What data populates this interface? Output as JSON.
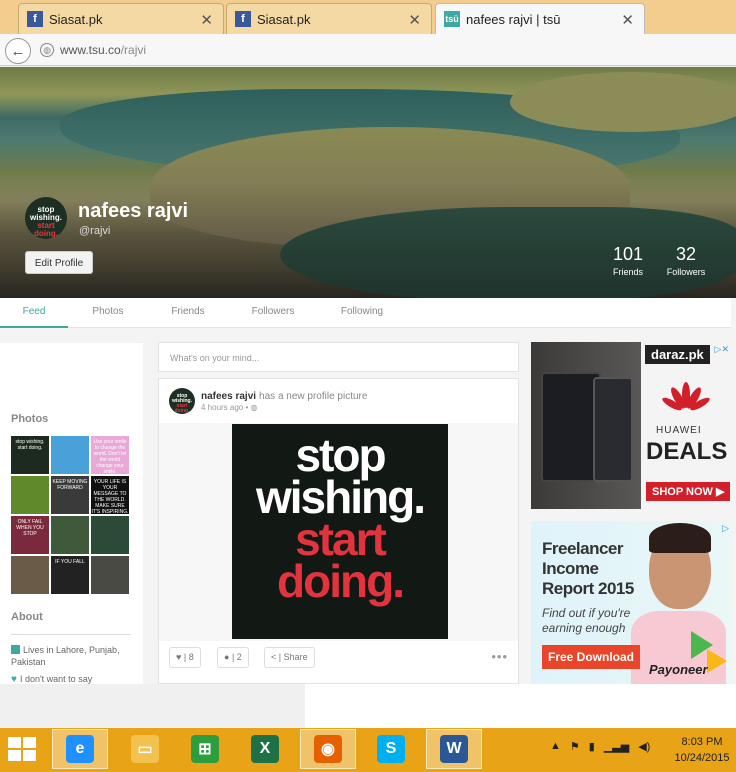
{
  "browser": {
    "tabs": [
      {
        "title": "Siasat.pk",
        "favicon": "facebook-icon"
      },
      {
        "title": "Siasat.pk",
        "favicon": "facebook-icon"
      },
      {
        "title": "nafees rajvi | tsū",
        "favicon": "tsu-icon",
        "active": true
      }
    ],
    "favicon_tsu_text": "tsū",
    "url_host": "www.tsu.co",
    "url_path": "/rajvi"
  },
  "profile": {
    "name": "nafees rajvi",
    "handle": "@rajvi",
    "edit_label": "Edit Profile",
    "avatar_text_1": "stop",
    "avatar_text_2": "wishing.",
    "avatar_text_3": "start",
    "avatar_text_4": "doing.",
    "friends_count": "101",
    "friends_label": "Friends",
    "followers_count": "32",
    "followers_label": "Followers"
  },
  "nav": {
    "tabs": [
      "Feed",
      "Photos",
      "Friends",
      "Followers",
      "Following"
    ],
    "active": "Feed"
  },
  "sidebar": {
    "photos_heading": "Photos",
    "thumbs": [
      {
        "text": "stop wishing. start doing.",
        "bg": "#1d2a1f"
      },
      {
        "text": "",
        "bg": "#4aa0d8"
      },
      {
        "text": "Use your smile to change the world. Don't let the world change your smile.",
        "bg": "#e9a8d8"
      },
      {
        "text": "",
        "bg": "#5e8a2a"
      },
      {
        "text": "KEEP MOVING FORWARD",
        "bg": "#3a3a3a"
      },
      {
        "text": "YOUR LIFE IS YOUR MESSAGE TO THE WORLD. MAKE SURE IT'S INSPIRING.",
        "bg": "#111111"
      },
      {
        "text": "ONLY FAIL WHEN YOU STOP",
        "bg": "#7a2a3a"
      },
      {
        "text": "",
        "bg": "#3f5a3a"
      },
      {
        "text": "",
        "bg": "#2c4a38"
      },
      {
        "text": "",
        "bg": "#6a5a48"
      },
      {
        "text": "IF YOU FALL",
        "bg": "#222222"
      },
      {
        "text": "",
        "bg": "#4a4a44"
      }
    ],
    "about_heading": "About",
    "location": "Lives in Lahore, Punjab, Pakistan",
    "relationship": "I don't want to say"
  },
  "composer": {
    "placeholder": "What's on your mind..."
  },
  "post": {
    "author": "nafees rajvi",
    "action": "has a new profile picture",
    "time": "4 hours ago •",
    "image_line1": "stop",
    "image_line2": "wishing.",
    "image_line3": "start",
    "image_line4": "doing.",
    "likes": "8",
    "comments": "2",
    "share_label": "Share",
    "more": "•••"
  },
  "ads": {
    "ad1": {
      "brand": "daraz.pk",
      "maker": "HUAWEI",
      "headline": "DEALS",
      "cta": "SHOP NOW ▶"
    },
    "ad2": {
      "headline_1": "Freelancer",
      "headline_2": "Income",
      "headline_3": "Report 2015",
      "sub_1": "Find out if you're",
      "sub_2": "earning enough",
      "cta": "Free Download",
      "brand": "Payoneer"
    }
  },
  "taskbar": {
    "apps": [
      {
        "name": "internet-explorer-icon",
        "glyph": "e",
        "color": "#1e90ff"
      },
      {
        "name": "file-explorer-icon",
        "glyph": "▭",
        "color": "#f2c14e"
      },
      {
        "name": "store-icon",
        "glyph": "⊞",
        "color": "#2e9d3e"
      },
      {
        "name": "excel-icon",
        "glyph": "X",
        "color": "#1e7145"
      },
      {
        "name": "firefox-icon",
        "glyph": "◉",
        "color": "#e66000"
      },
      {
        "name": "skype-icon",
        "glyph": "S",
        "color": "#00aff0"
      },
      {
        "name": "word-icon",
        "glyph": "W",
        "color": "#2b5797"
      }
    ],
    "time": "8:03 PM",
    "date": "10/24/2015"
  }
}
